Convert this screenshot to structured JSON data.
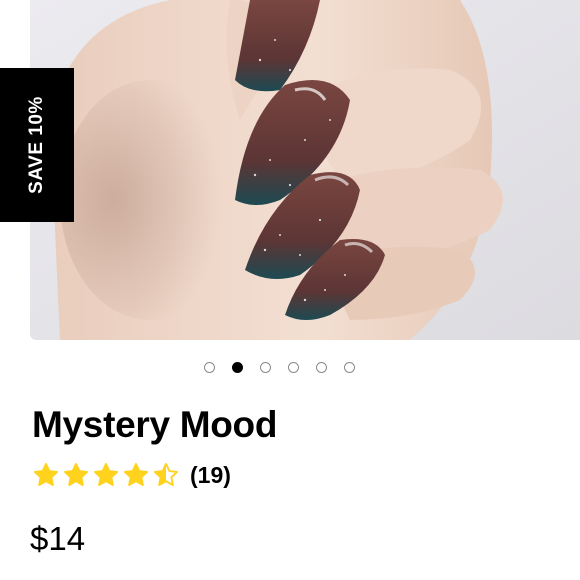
{
  "badge": {
    "text": "SAVE 10%"
  },
  "carousel": {
    "total": 6,
    "active_index": 1
  },
  "product": {
    "title": "Mystery Mood",
    "rating": 4.5,
    "rating_max": 5,
    "review_count": "(19)",
    "price": "$14"
  },
  "colors": {
    "star": "#FFD21E",
    "badge_bg": "#000000",
    "dot_active": "#000000",
    "dot_inactive": "#8a8a8a",
    "nail_base": "#6b3a34",
    "nail_tip": "#1d4a52"
  }
}
